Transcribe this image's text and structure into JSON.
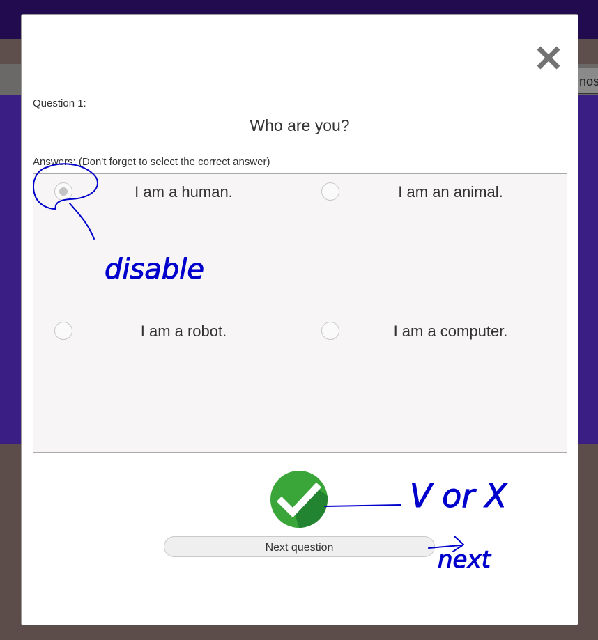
{
  "background": {
    "right_button_partial": "nos"
  },
  "modal": {
    "close_symbol": "✕",
    "question_number": "Question 1:",
    "question_text": "Who are you?",
    "answers_label": "Answers: (Don't forget to select the correct answer)",
    "answers": [
      {
        "text": "I am a human.",
        "disabled": true
      },
      {
        "text": "I am an animal.",
        "disabled": false
      },
      {
        "text": "I am a robot.",
        "disabled": false
      },
      {
        "text": "I am a computer.",
        "disabled": false
      }
    ],
    "next_label": "Next question",
    "check_icon": "checkmark-icon",
    "colors": {
      "check_green": "#3aa63a",
      "check_dark": "#1e7d2e",
      "annotation_blue": "#0000cc"
    }
  },
  "annotations": {
    "note_disable": "disable",
    "note_vx": "V or X",
    "note_next": "next"
  }
}
